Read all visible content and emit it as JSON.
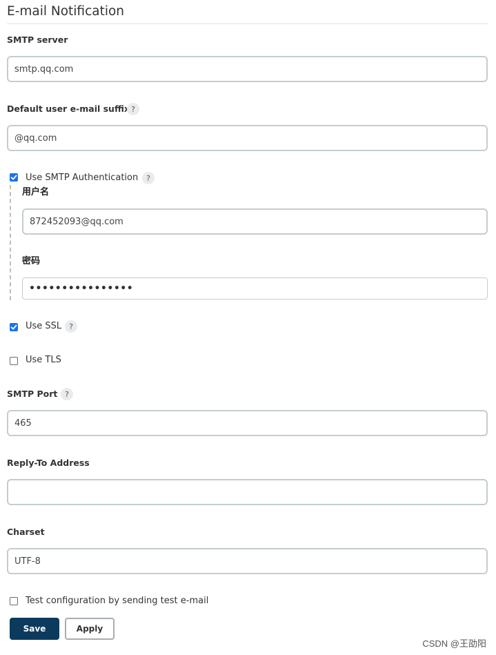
{
  "section": {
    "title": "E-mail Notification"
  },
  "smtp_server": {
    "label": "SMTP server",
    "value": "smtp.qq.com"
  },
  "default_suffix": {
    "label": "Default user e-mail suffix",
    "value": "@qq.com",
    "help_icon": "?"
  },
  "smtp_auth": {
    "label": "Use SMTP Authentication",
    "checked": true,
    "help_icon": "?",
    "username": {
      "label": "用户名",
      "value": "872452093@qq.com"
    },
    "password": {
      "label": "密码",
      "masked_value": "••••••••••••••••"
    }
  },
  "use_ssl": {
    "label": "Use SSL",
    "checked": true,
    "help_icon": "?"
  },
  "use_tls": {
    "label": "Use TLS",
    "checked": false
  },
  "smtp_port": {
    "label": "SMTP Port",
    "value": "465",
    "help_icon": "?"
  },
  "reply_to": {
    "label": "Reply-To Address",
    "value": ""
  },
  "charset": {
    "label": "Charset",
    "value": "UTF-8"
  },
  "test_config": {
    "label": "Test configuration by sending test e-mail",
    "checked": false
  },
  "buttons": {
    "save": "Save",
    "apply": "Apply"
  },
  "watermark": "CSDN @王劭阳",
  "colors": {
    "save_button": "#0b3a5c",
    "checkbox_checked": "#1a73e8",
    "input_border": "#c4ccd0"
  }
}
